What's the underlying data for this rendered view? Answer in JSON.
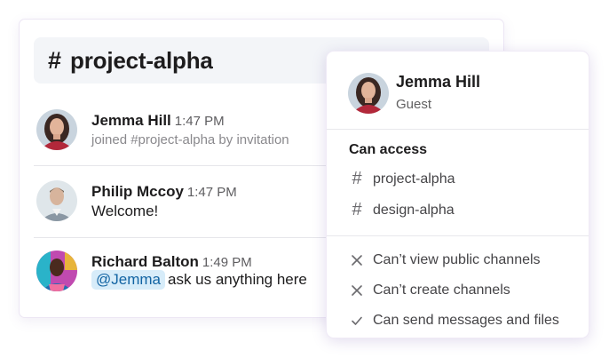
{
  "channel": {
    "hash": "#",
    "name": "project-alpha"
  },
  "messages": [
    {
      "author": "Jemma Hill",
      "time": "1:47 PM",
      "text": "joined #project-alpha by invitation"
    },
    {
      "author": "Philip Mccoy",
      "time": "1:47 PM",
      "text": "Welcome!"
    },
    {
      "author": "Richard Balton",
      "time": "1:49 PM",
      "mention": "@Jemma",
      "text": "ask us anything here"
    }
  ],
  "popover": {
    "name": "Jemma Hill",
    "role": "Guest",
    "section_title": "Can access",
    "channels": [
      "project-alpha",
      "design-alpha"
    ],
    "permissions": [
      {
        "icon": "x-icon",
        "label": "Can’t view public channels"
      },
      {
        "icon": "x-icon",
        "label": "Can’t create channels"
      },
      {
        "icon": "check-icon",
        "label": "Can send messages and files"
      }
    ]
  },
  "colors": {
    "mention_bg": "#d7ecf9",
    "mention_text": "#1264a3",
    "header_bg": "#f3f5f8"
  },
  "icons": {
    "avatar_1": "jemma-avatar",
    "avatar_2": "philip-avatar",
    "avatar_3": "richard-avatar"
  }
}
